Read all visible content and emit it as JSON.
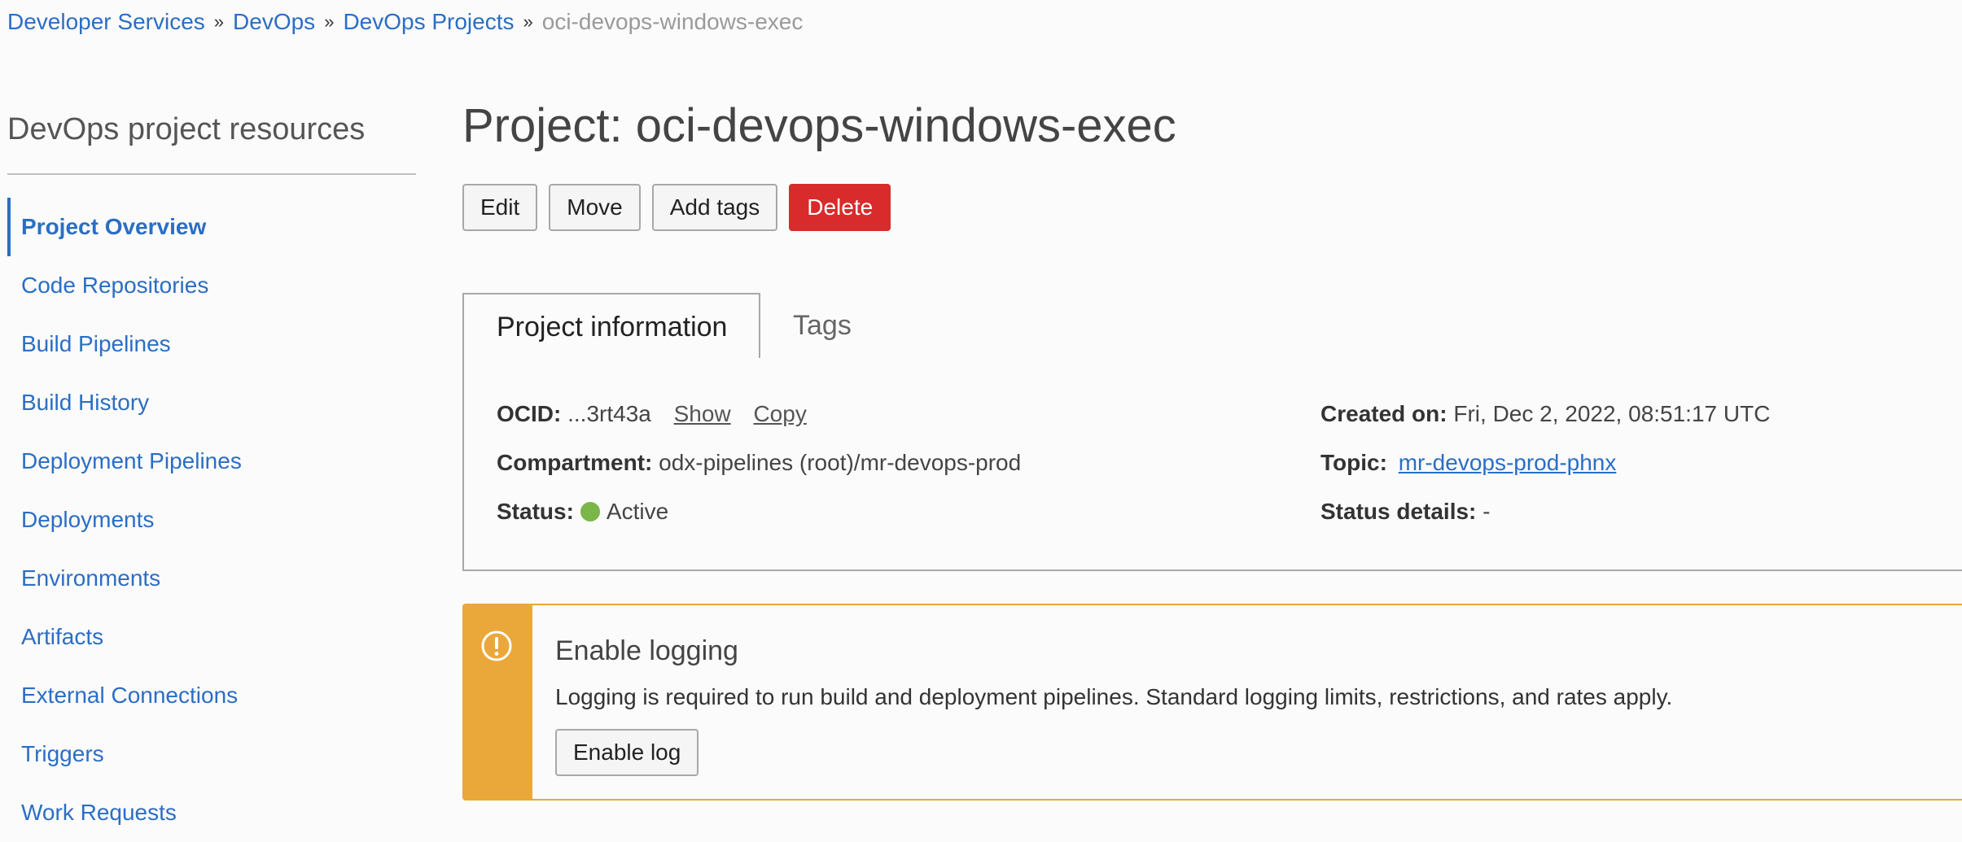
{
  "breadcrumb": {
    "items": [
      "Developer Services",
      "DevOps",
      "DevOps Projects"
    ],
    "current": "oci-devops-windows-exec",
    "separator": "»"
  },
  "sidebar": {
    "title": "DevOps project resources",
    "items": [
      {
        "label": "Project Overview",
        "active": true
      },
      {
        "label": "Code Repositories"
      },
      {
        "label": "Build Pipelines"
      },
      {
        "label": "Build History"
      },
      {
        "label": "Deployment Pipelines"
      },
      {
        "label": "Deployments"
      },
      {
        "label": "Environments"
      },
      {
        "label": "Artifacts"
      },
      {
        "label": "External Connections"
      },
      {
        "label": "Triggers"
      },
      {
        "label": "Work Requests"
      }
    ]
  },
  "main": {
    "title": "Project: oci-devops-windows-exec",
    "actions": {
      "edit": "Edit",
      "move": "Move",
      "add_tags": "Add tags",
      "delete": "Delete"
    },
    "tabs": [
      {
        "label": "Project information",
        "active": true
      },
      {
        "label": "Tags"
      }
    ],
    "info": {
      "ocid_label": "OCID:",
      "ocid_value": "...3rt43a",
      "ocid_show": "Show",
      "ocid_copy": "Copy",
      "compartment_label": "Compartment:",
      "compartment_value": "odx-pipelines (root)/mr-devops-prod",
      "status_label": "Status:",
      "status_value": "Active",
      "status_color": "#7ab648",
      "created_label": "Created on:",
      "created_value": "Fri, Dec 2, 2022, 08:51:17 UTC",
      "topic_label": "Topic:",
      "topic_value": "mr-devops-prod-phnx",
      "status_details_label": "Status details:",
      "status_details_value": "-"
    },
    "alert": {
      "icon": "exclamation-circle-icon",
      "title": "Enable logging",
      "text": "Logging is required to run build and deployment pipelines. Standard logging limits, restrictions, and rates apply.",
      "button": "Enable log",
      "color": "#eaa83a"
    }
  },
  "colors": {
    "link": "#2b6ec4",
    "delete": "#d92b2b",
    "warning": "#eaa83a"
  }
}
